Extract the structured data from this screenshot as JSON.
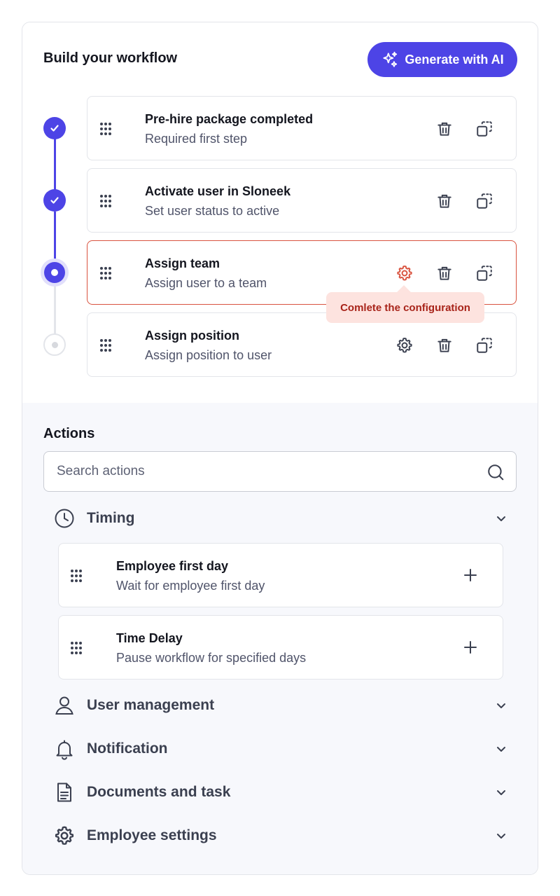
{
  "header": {
    "title": "Build your workflow",
    "generate_label": "Generate with AI"
  },
  "steps": [
    {
      "title": "Pre-hire package completed",
      "subtitle": "Required first step",
      "state": "done"
    },
    {
      "title": "Activate user in Sloneek",
      "subtitle": "Set user status to active",
      "state": "done"
    },
    {
      "title": "Assign team",
      "subtitle": "Assign user to a team",
      "state": "current"
    },
    {
      "title": "Assign position",
      "subtitle": "Assign position to user",
      "state": "todo"
    }
  ],
  "tooltip": {
    "text": "Comlete the configuration"
  },
  "actions": {
    "title": "Actions",
    "search_placeholder": "Search actions",
    "categories": [
      {
        "label": "Timing",
        "icon": "clock-icon",
        "expanded": true,
        "items": [
          {
            "title": "Employee first day",
            "subtitle": "Wait for employee first day"
          },
          {
            "title": "Time Delay",
            "subtitle": "Pause workflow for specified days"
          }
        ]
      },
      {
        "label": "User management",
        "icon": "user-icon",
        "expanded": false
      },
      {
        "label": "Notification",
        "icon": "bell-icon",
        "expanded": false
      },
      {
        "label": "Documents and task",
        "icon": "document-icon",
        "expanded": false
      },
      {
        "label": "Employee settings",
        "icon": "gear-icon",
        "expanded": false
      }
    ]
  },
  "colors": {
    "accent": "#4d44e6",
    "error": "#d9533f",
    "tooltip_bg": "#fde3df",
    "tooltip_text": "#a8241a"
  }
}
